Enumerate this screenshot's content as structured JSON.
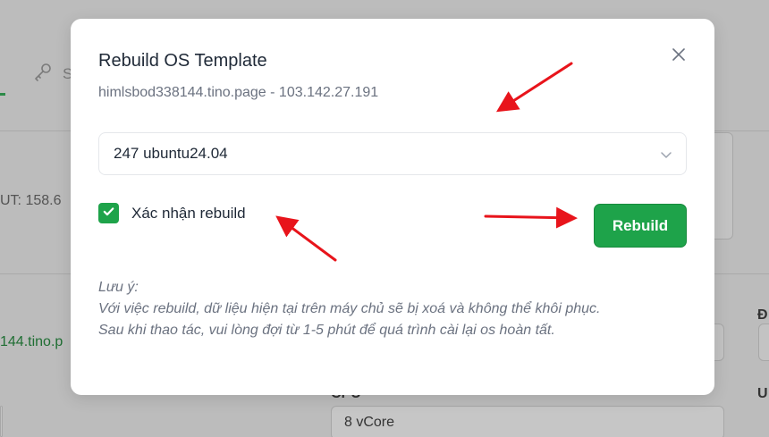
{
  "background": {
    "tab_label": "S",
    "left_text": "UT: 158.6",
    "left_link": "144.tino.p",
    "right_label_1": "Đ",
    "right_label_2": "U",
    "cpu_label": "CPU",
    "cpu_value": "8 vCore"
  },
  "modal": {
    "title": "Rebuild OS Template",
    "subtitle": "himlsbod338144.tino.page - 103.142.27.191",
    "select": {
      "value": "247 ubuntu24.04"
    },
    "confirm": {
      "label": "Xác nhận rebuild",
      "checked": true
    },
    "rebuild_button": "Rebuild",
    "note": {
      "title": "Lưu ý:",
      "line1": "Với việc rebuild, dữ liệu hiện tại trên máy chủ sẽ bị xoá và không thể khôi phục.",
      "line2": "Sau khi thao tác, vui lòng đợi từ 1-5 phút để quá trình cài lại os hoàn tất."
    }
  },
  "colors": {
    "accent": "#1ea34a",
    "annotation": "#e8141b",
    "overlay": "#bcbcbc"
  },
  "icons": [
    "key-icon",
    "close-icon",
    "chevron-down-icon",
    "checkmark-icon"
  ]
}
